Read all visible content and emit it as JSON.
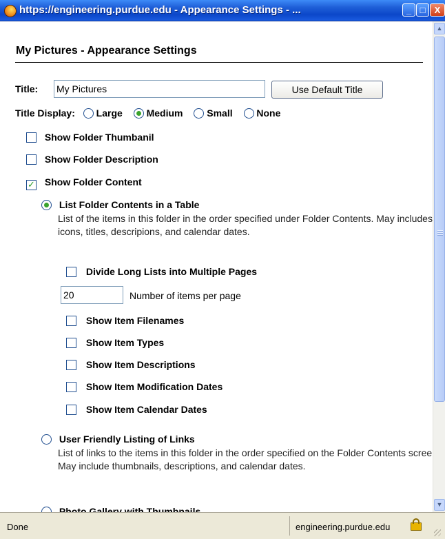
{
  "window": {
    "title": "https://engineering.purdue.edu - Appearance Settings - ...",
    "minimize_glyph": "_",
    "maximize_glyph": "□",
    "close_glyph": "X"
  },
  "page": {
    "heading": "My Pictures - Appearance Settings",
    "title_label": "Title:",
    "title_value": "My Pictures",
    "use_default_button": "Use Default Title",
    "title_display_label": "Title Display:",
    "title_display_options": [
      {
        "label": "Large",
        "selected": false
      },
      {
        "label": "Medium",
        "selected": true
      },
      {
        "label": "Small",
        "selected": false
      },
      {
        "label": "None",
        "selected": false
      }
    ],
    "checks": [
      {
        "label": "Show Folder Thumbanil",
        "checked": false
      },
      {
        "label": "Show Folder Description",
        "checked": false
      },
      {
        "label": "Show Folder Content",
        "checked": true
      }
    ],
    "content_options": [
      {
        "label": "List Folder Contents in a Table",
        "selected": true,
        "description": "List of the items in this folder in the order specified under Folder Contents. May includes icons, titles, descripions, and calendar dates."
      },
      {
        "label": "User Friendly Listing of Links",
        "selected": false,
        "description": "List of links to the items in this folder in the order specified on the Folder Contents screen. May include thumbnails, descriptions, and calendar dates."
      },
      {
        "label": "Photo Gallery with Thumbnails",
        "selected": false
      }
    ],
    "divide_pages": {
      "label": "Divide Long Lists into Multiple Pages",
      "checked": false
    },
    "items_per_page": {
      "value": "20",
      "label": "Number of items per page"
    },
    "item_checks": [
      {
        "label": "Show Item Filenames",
        "checked": false
      },
      {
        "label": "Show Item Types",
        "checked": false
      },
      {
        "label": "Show Item Descriptions",
        "checked": false
      },
      {
        "label": "Show Item Modification Dates",
        "checked": false
      },
      {
        "label": "Show Item Calendar Dates",
        "checked": false
      }
    ]
  },
  "statusbar": {
    "left": "Done",
    "right": "engineering.purdue.edu"
  }
}
